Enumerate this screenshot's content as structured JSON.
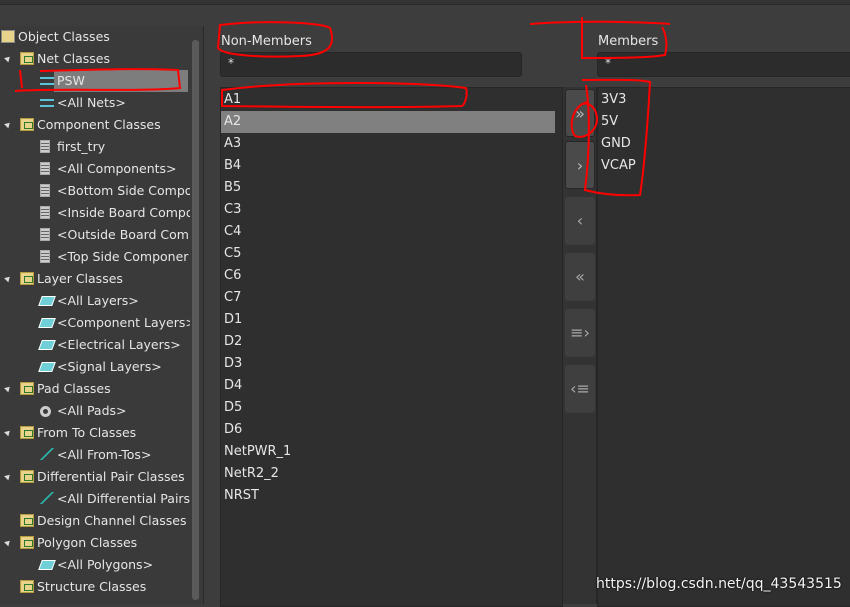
{
  "tree": {
    "items": [
      {
        "label": "Object Classes",
        "level": 0,
        "icon": "top"
      },
      {
        "label": "Net Classes",
        "level": 1,
        "icon": "folder",
        "expanded": true
      },
      {
        "label": "PSW",
        "level": 2,
        "icon": "net",
        "selected": true
      },
      {
        "label": "<All Nets>",
        "level": 2,
        "icon": "net"
      },
      {
        "label": "Component Classes",
        "level": 1,
        "icon": "folder",
        "expanded": true
      },
      {
        "label": "first_try",
        "level": 2,
        "icon": "comp"
      },
      {
        "label": "<All Components>",
        "level": 2,
        "icon": "comp"
      },
      {
        "label": "<Bottom Side Compo",
        "level": 2,
        "icon": "comp"
      },
      {
        "label": "<Inside Board Compo",
        "level": 2,
        "icon": "comp"
      },
      {
        "label": "<Outside Board Com",
        "level": 2,
        "icon": "comp"
      },
      {
        "label": "<Top Side Componer",
        "level": 2,
        "icon": "comp"
      },
      {
        "label": "Layer Classes",
        "level": 1,
        "icon": "folder",
        "expanded": true
      },
      {
        "label": "<All Layers>",
        "level": 2,
        "icon": "layer"
      },
      {
        "label": "<Component Layers>",
        "level": 2,
        "icon": "layer"
      },
      {
        "label": "<Electrical Layers>",
        "level": 2,
        "icon": "layer"
      },
      {
        "label": "<Signal Layers>",
        "level": 2,
        "icon": "layer"
      },
      {
        "label": "Pad Classes",
        "level": 1,
        "icon": "folder",
        "expanded": true
      },
      {
        "label": "<All Pads>",
        "level": 2,
        "icon": "pad"
      },
      {
        "label": "From To Classes",
        "level": 1,
        "icon": "folder",
        "expanded": true
      },
      {
        "label": "<All From-Tos>",
        "level": 2,
        "icon": "ft"
      },
      {
        "label": "Differential Pair Classes",
        "level": 1,
        "icon": "folder",
        "expanded": true
      },
      {
        "label": "<All Differential Pairs:",
        "level": 2,
        "icon": "ft"
      },
      {
        "label": "Design Channel Classes",
        "level": 1,
        "icon": "folder",
        "expanded": false
      },
      {
        "label": "Polygon Classes",
        "level": 1,
        "icon": "folder",
        "expanded": true
      },
      {
        "label": "<All Polygons>",
        "level": 2,
        "icon": "layer"
      },
      {
        "label": "Structure Classes",
        "level": 1,
        "icon": "folder",
        "expanded": false
      }
    ]
  },
  "non_members": {
    "label": "Non-Members",
    "filter": "*",
    "items": [
      "A1",
      "A2",
      "A3",
      "B4",
      "B5",
      "C3",
      "C4",
      "C5",
      "C6",
      "C7",
      "D1",
      "D2",
      "D3",
      "D4",
      "D5",
      "D6",
      "NetPWR_1",
      "NetR2_2",
      "NRST"
    ],
    "selected": "A2"
  },
  "members": {
    "label": "Members",
    "filter": "*",
    "items": [
      "3V3",
      "5V",
      "GND",
      "VCAP"
    ]
  },
  "buttons": [
    {
      "name": "add-all-button",
      "glyph": "»"
    },
    {
      "name": "add-button",
      "glyph": "›"
    },
    {
      "name": "remove-button",
      "glyph": "‹"
    },
    {
      "name": "remove-all-button",
      "glyph": "«"
    },
    {
      "name": "add-filtered-button",
      "glyph": "≡›"
    },
    {
      "name": "remove-filtered-button",
      "glyph": "‹≡"
    }
  ],
  "watermark": "https://blog.csdn.net/qq_43543515",
  "colors": {
    "annotation": "#ff0000",
    "selection": "#808080"
  }
}
